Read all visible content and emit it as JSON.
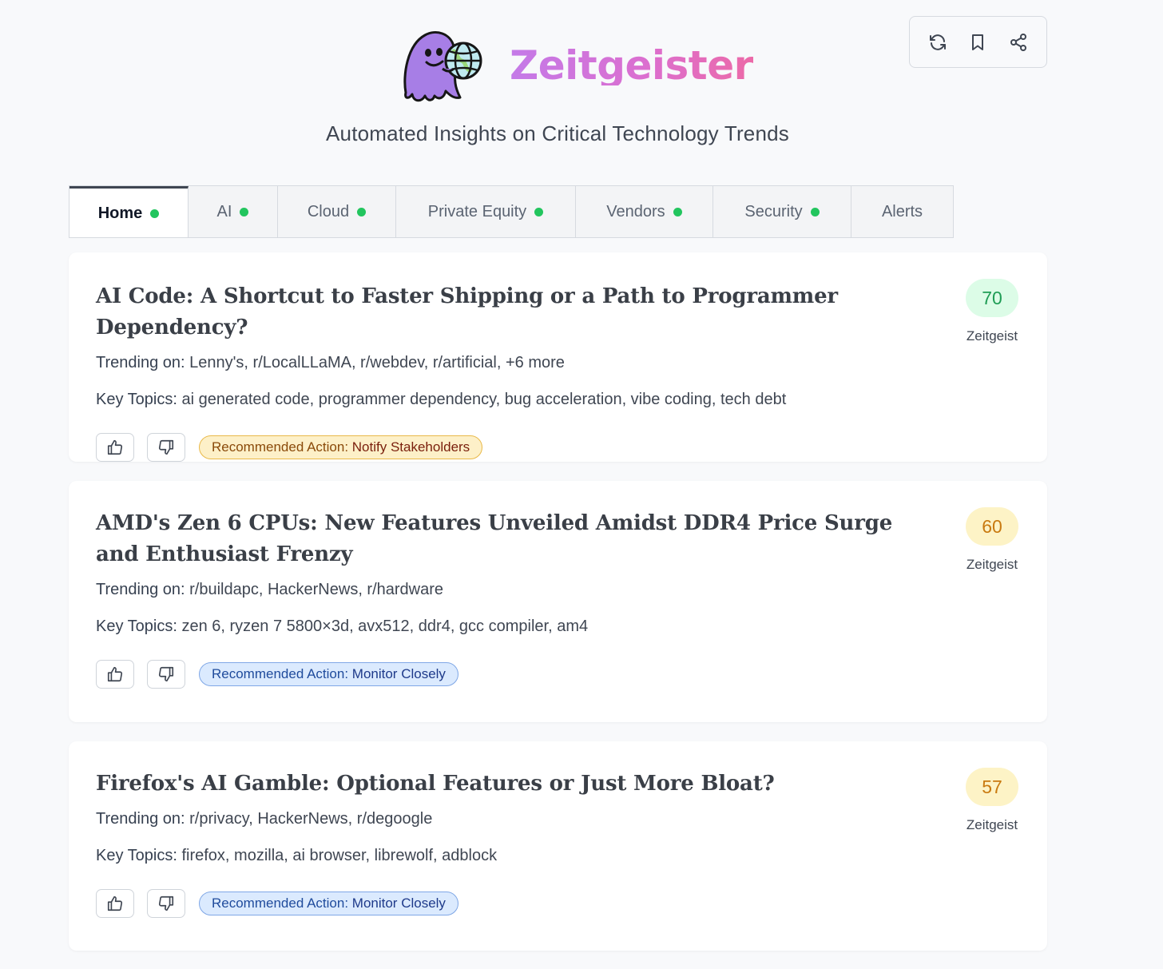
{
  "header": {
    "title": "Zeitgeister",
    "subtitle": "Automated Insights on Critical Technology Trends",
    "logo_icon": "ghost-holding-globe-icon"
  },
  "toolbar": {
    "refresh_icon": "refresh-icon",
    "bookmark_icon": "bookmark-icon",
    "share_icon": "share-icon"
  },
  "tabs": [
    {
      "label": "Home",
      "active": true,
      "indicator": true
    },
    {
      "label": "AI",
      "active": false,
      "indicator": true
    },
    {
      "label": "Cloud",
      "active": false,
      "indicator": true
    },
    {
      "label": "Private Equity",
      "active": false,
      "indicator": true
    },
    {
      "label": "Vendors",
      "active": false,
      "indicator": true
    },
    {
      "label": "Security",
      "active": false,
      "indicator": true
    },
    {
      "label": "Alerts",
      "active": false,
      "indicator": false
    }
  ],
  "labels": {
    "trending": "Trending on:",
    "topics": "Key Topics:",
    "action_prefix": "Recommended Action:",
    "score_label": "Zeitgeist"
  },
  "cards": [
    {
      "title": "AI Code: A Shortcut to Faster Shipping or a Path to Programmer Dependency?",
      "trending": "Lenny's, r/LocalLLaMA, r/webdev, r/artificial, +6 more",
      "topics": "ai generated code, programmer dependency, bug acceleration, vibe coding, tech debt",
      "action": "Notify Stakeholders",
      "score": "70"
    },
    {
      "title": "AMD's Zen 6 CPUs: New Features Unveiled Amidst DDR4 Price Surge and Enthusiast Frenzy",
      "trending": "r/buildapc, HackerNews, r/hardware",
      "topics": "zen 6, ryzen 7 5800×3d, avx512, ddr4, gcc compiler, am4",
      "action": "Monitor Closely",
      "score": "60"
    },
    {
      "title": "Firefox's AI Gamble: Optional Features or Just More Bloat?",
      "trending": "r/privacy, HackerNews, r/degoogle",
      "topics": "firefox, mozilla, ai browser, librewolf, adblock",
      "action": "Monitor Closely",
      "score": "57"
    }
  ],
  "colors": {
    "indicator_green": "#22c55e",
    "score_high": "#1f9d55",
    "score_mid": "#c97a10",
    "brand_gradient_start": "#c47ae8",
    "brand_gradient_end": "#ec6aa8"
  }
}
